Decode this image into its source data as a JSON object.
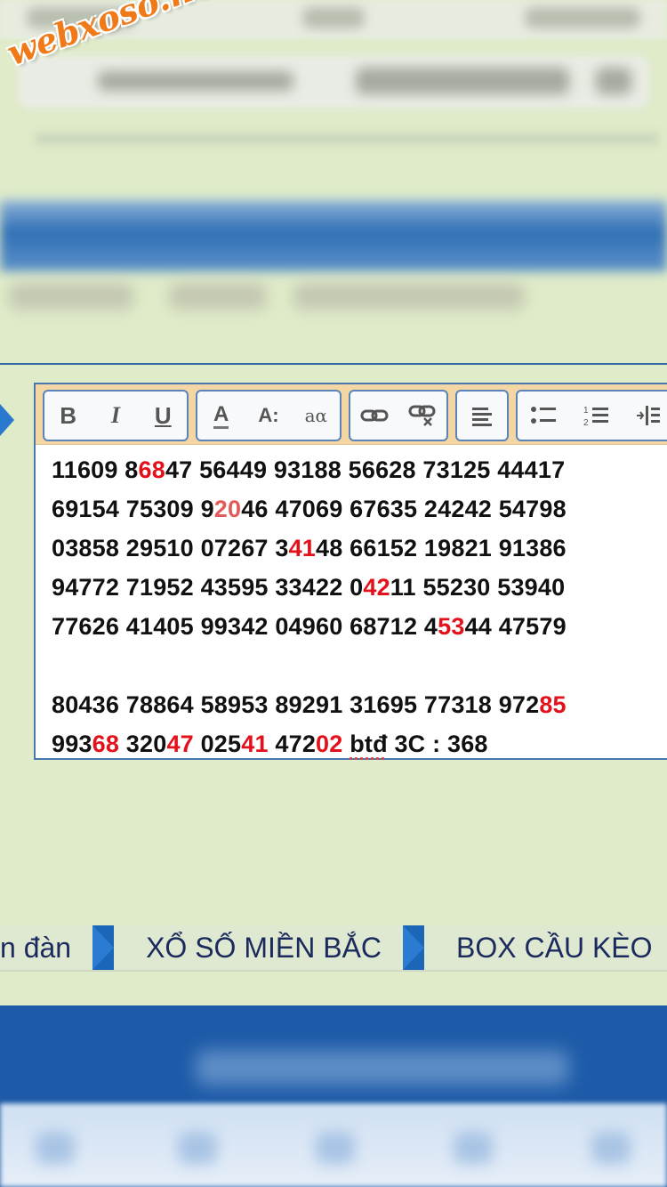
{
  "watermark": "webxoso.net",
  "toolbar": {
    "bold": "B",
    "italic": "I",
    "underline": "U",
    "font_color": "A",
    "font_size": "A:",
    "font_face": "aα",
    "link": "⛓",
    "unlink": "⛓",
    "align": "≡",
    "bullet_list": "•≡",
    "numbered_list": "1≡",
    "indent": "⇥"
  },
  "content": {
    "lines": [
      [
        {
          "t": "11609 8"
        },
        {
          "t": "68",
          "h": true
        },
        {
          "t": "47 56449 93188 56628 73125 44417"
        }
      ],
      [
        {
          "t": "69154 75309 9"
        },
        {
          "t": "20",
          "h": "light"
        },
        {
          "t": "46 47069 67635 24242 54798"
        }
      ],
      [
        {
          "t": "03858 29510 07267 3"
        },
        {
          "t": "41",
          "h": true
        },
        {
          "t": "48 66152 19821 91386"
        }
      ],
      [
        {
          "t": "94772 71952 43595 33422 0"
        },
        {
          "t": "42",
          "h": true
        },
        {
          "t": "11 55230 53940"
        }
      ],
      [
        {
          "t": "77626 41405 99342 04960 68712 4"
        },
        {
          "t": "53",
          "h": true
        },
        {
          "t": "44 47579"
        }
      ],
      [],
      [
        {
          "t": "80436 78864 58953 89291 31695 77318 972"
        },
        {
          "t": "85",
          "h": true
        }
      ],
      [
        {
          "t": "993"
        },
        {
          "t": "68",
          "h": true
        },
        {
          "t": " 320"
        },
        {
          "t": "47",
          "h": true
        },
        {
          "t": " 025"
        },
        {
          "t": "41",
          "h": true
        },
        {
          "t": " 472"
        },
        {
          "t": "02",
          "h": true
        },
        {
          "t": " "
        },
        {
          "t": "btđ",
          "w": true
        },
        {
          "t": " 3C : 368"
        }
      ]
    ]
  },
  "nav": {
    "items": [
      "n đàn",
      "XỔ SỐ MIỀN BẮC",
      "BOX CẦU KÈO"
    ]
  },
  "colors": {
    "highlight": "#e3111b",
    "nav_arrow": "#2b7bd2",
    "toolbar_bg": "#f3d6a3"
  }
}
